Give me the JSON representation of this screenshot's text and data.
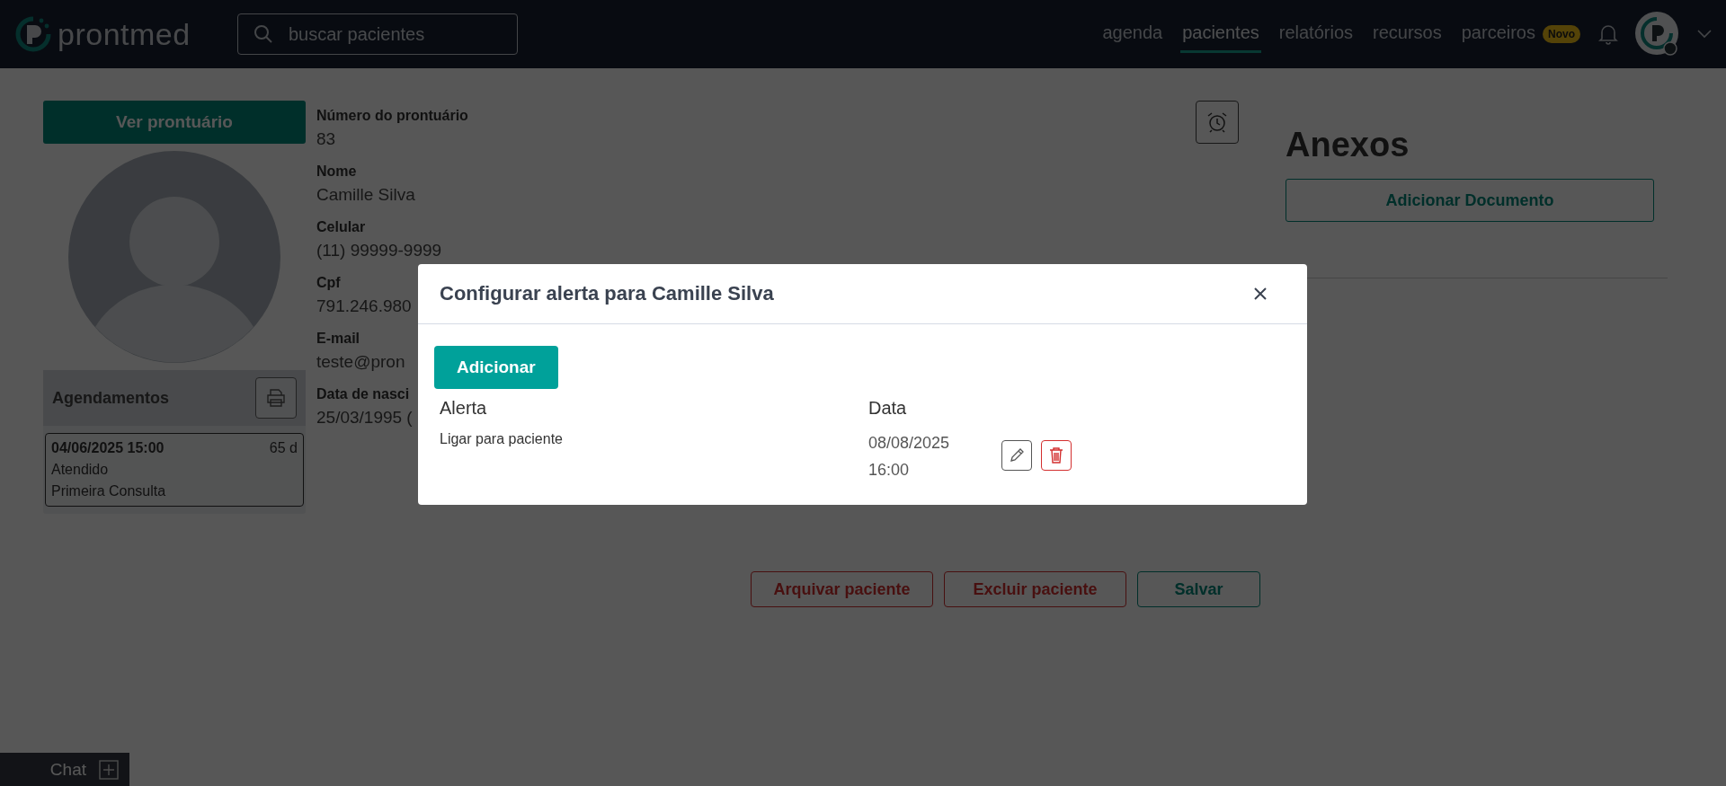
{
  "header": {
    "logo_text": "prontmed",
    "search": {
      "placeholder": "buscar pacientes"
    },
    "nav": [
      {
        "label": "agenda",
        "selected": false
      },
      {
        "label": "pacientes",
        "selected": true
      },
      {
        "label": "relatórios",
        "selected": false
      },
      {
        "label": "recursos",
        "selected": false
      },
      {
        "label": "parceiros",
        "selected": false,
        "badge": "Novo"
      }
    ]
  },
  "patient": {
    "record_button": "Ver prontuário",
    "fields": [
      {
        "label": "Número do prontuário",
        "value": "83"
      },
      {
        "label": "Nome",
        "value": "Camille Silva"
      },
      {
        "label": "Celular",
        "value": "(11) 99999-9999"
      },
      {
        "label": "Cpf",
        "value": "791.246.980"
      },
      {
        "label": "E-mail",
        "value": "teste@pron"
      },
      {
        "label": "Data de nasci",
        "value": "25/03/1995 ("
      }
    ],
    "appointments_title": "Agendamentos",
    "appointments": [
      {
        "datetime": "04/06/2025 15:00",
        "days": "65 d",
        "status": "Atendido",
        "type": "Primeira Consulta"
      }
    ],
    "actions": [
      {
        "label": "Arquivar paciente",
        "kind": "danger"
      },
      {
        "label": "Excluir paciente",
        "kind": "danger"
      },
      {
        "label": "Salvar",
        "kind": "primary"
      }
    ]
  },
  "attachments": {
    "title": "Anexos",
    "button": "Adicionar Documento"
  },
  "chat": {
    "label": "Chat"
  },
  "modal": {
    "title": "Configurar alerta para Camille Silva",
    "add_button": "Adicionar",
    "columns": [
      "Alerta",
      "Data"
    ],
    "rows": [
      {
        "alert": "Ligar para paciente",
        "date": "08/08/2025 16:00"
      }
    ]
  }
}
